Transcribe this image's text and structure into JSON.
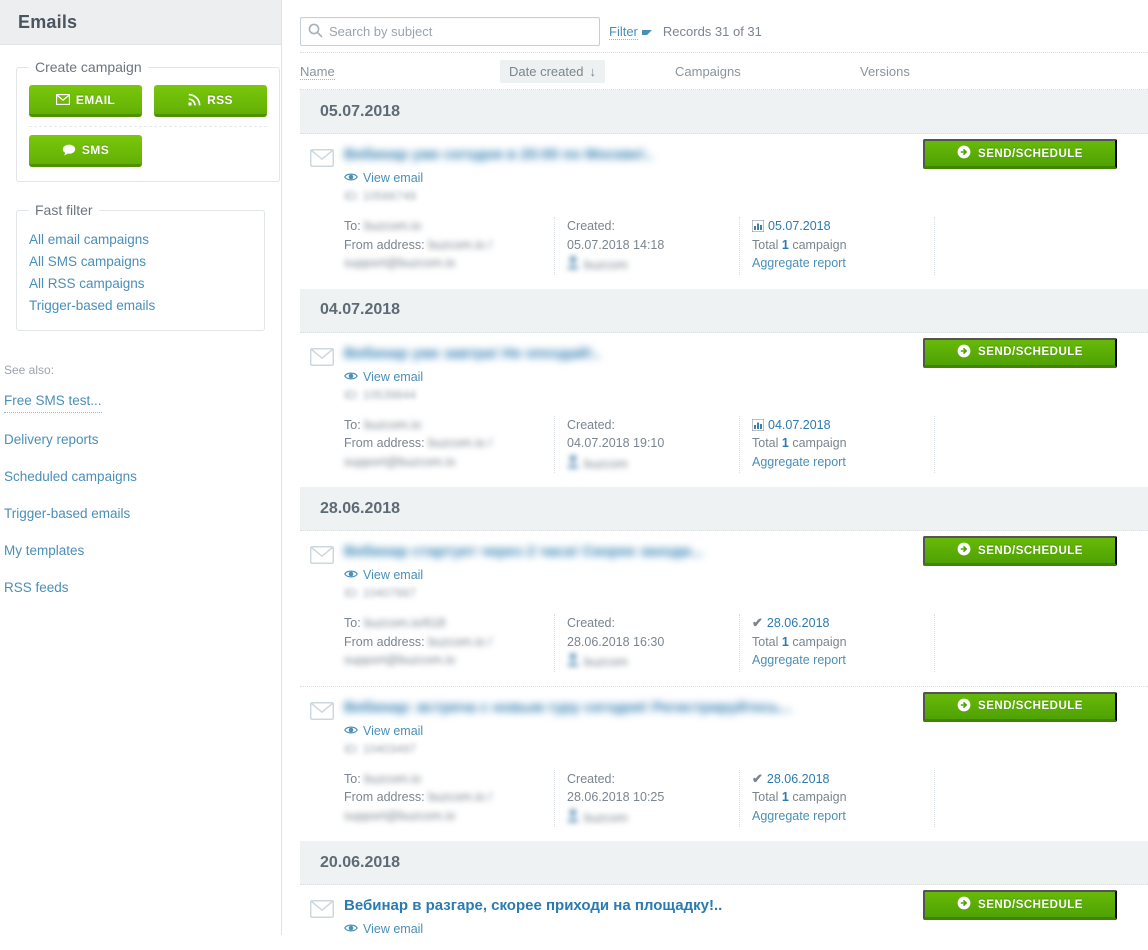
{
  "sidebar": {
    "header_title": "Emails",
    "create_campaign": {
      "legend": "Create campaign",
      "buttons": [
        {
          "label": "EMAIL",
          "icon": "envelope-icon",
          "color": "#6fbb06"
        },
        {
          "label": "RSS",
          "icon": "rss-icon",
          "color": "#6fbb06"
        },
        {
          "label": "SMS",
          "icon": "chat-bubble-icon",
          "color": "#6fbb06"
        }
      ]
    },
    "fast_filter": {
      "legend": "Fast filter",
      "items": [
        {
          "label": "All email campaigns"
        },
        {
          "label": "All SMS campaigns"
        },
        {
          "label": "All RSS campaigns"
        },
        {
          "label": "Trigger-based emails"
        }
      ]
    },
    "see_also": {
      "label": "See also:",
      "items": [
        {
          "label": "Free SMS test...",
          "dotted": true
        },
        {
          "label": "Delivery reports",
          "dotted": false
        },
        {
          "label": "Scheduled campaigns",
          "dotted": false
        },
        {
          "label": "Trigger-based emails",
          "dotted": false
        },
        {
          "label": "My templates",
          "dotted": false
        },
        {
          "label": "RSS feeds",
          "dotted": false
        }
      ]
    }
  },
  "toolbar": {
    "search_placeholder": "Search by subject",
    "search_value": "",
    "search_icon": "search-icon",
    "filter_label": "Filter",
    "records_label": "Records 31 of 31"
  },
  "table": {
    "columns": {
      "name": "Name",
      "date_created": "Date created",
      "sort_arrow": "↓",
      "campaigns": "Campaigns",
      "versions": "Versions"
    },
    "groups": [
      {
        "date": "05.07.2018",
        "rows": [
          {
            "subject": "Вебинар уже сегодня в 20:00 по Москве!..",
            "subject_blurred": true,
            "view_email": "View email",
            "id_line": "ID: 10566749",
            "id_blurred": true,
            "to_label": "To:",
            "to_value": "buzcom.io",
            "from_label": "From address:",
            "from_value": "buzcom.io / support@buzcom.io",
            "created_label": "Created:",
            "created_value": "05.07.2018 14:18",
            "creator": "buzcom",
            "campaign_icon": "bar-chart-icon",
            "campaign_date": "05.07.2018",
            "campaign_total_prefix": "Total",
            "campaign_total_count": "1",
            "campaign_total_suffix": "campaign",
            "aggregate_report": "Aggregate report",
            "send_button": "SEND/SCHEDULE"
          }
        ]
      },
      {
        "date": "04.07.2018",
        "rows": [
          {
            "subject": "Вебинар уже завтра! Не опоздай!..",
            "subject_blurred": true,
            "view_email": "View email",
            "id_line": "ID: 10539844",
            "id_blurred": true,
            "to_label": "To:",
            "to_value": "buzcom.io",
            "from_label": "From address:",
            "from_value": "buzcom.io / support@buzcom.io",
            "created_label": "Created:",
            "created_value": "04.07.2018 19:10",
            "creator": "buzcom",
            "campaign_icon": "bar-chart-icon",
            "campaign_date": "04.07.2018",
            "campaign_total_prefix": "Total",
            "campaign_total_count": "1",
            "campaign_total_suffix": "campaign",
            "aggregate_report": "Aggregate report",
            "send_button": "SEND/SCHEDULE"
          }
        ]
      },
      {
        "date": "28.06.2018",
        "rows": [
          {
            "subject": "Вебинар стартует через 2 часа! Скорее заходи...",
            "subject_blurred": true,
            "view_email": "View email",
            "id_line": "ID: 10407887",
            "id_blurred": true,
            "to_label": "To:",
            "to_value": "buzcom.io/618",
            "from_label": "From address:",
            "from_value": "buzcom.io / support@buzcom.io",
            "created_label": "Created:",
            "created_value": "28.06.2018 16:30",
            "creator": "buzcom",
            "campaign_icon": "check-icon",
            "campaign_date": "28.06.2018",
            "campaign_total_prefix": "Total",
            "campaign_total_count": "1",
            "campaign_total_suffix": "campaign",
            "aggregate_report": "Aggregate report",
            "send_button": "SEND/SCHEDULE"
          },
          {
            "subject": "Вебинар: встреча с новым гуру сегодня! Регистрируйтесь...",
            "subject_blurred": true,
            "view_email": "View email",
            "id_line": "ID: 10403497",
            "id_blurred": true,
            "to_label": "To:",
            "to_value": "buzcom.io",
            "from_label": "From address:",
            "from_value": "buzcom.io / support@buzcom.io",
            "created_label": "Created:",
            "created_value": "28.06.2018 10:25",
            "creator": "buzcom",
            "campaign_icon": "check-icon",
            "campaign_date": "28.06.2018",
            "campaign_total_prefix": "Total",
            "campaign_total_count": "1",
            "campaign_total_suffix": "campaign",
            "aggregate_report": "Aggregate report",
            "send_button": "SEND/SCHEDULE"
          }
        ]
      },
      {
        "date": "20.06.2018",
        "rows": [
          {
            "subject": "Вебинар в разгаре, скорее приходи на площадку!..",
            "subject_blurred": false,
            "view_email": "View email",
            "id_line": "",
            "id_blurred": false,
            "to_label": "",
            "to_value": "",
            "from_label": "",
            "from_value": "",
            "created_label": "",
            "created_value": "",
            "creator": "",
            "campaign_icon": "",
            "campaign_date": "",
            "campaign_total_prefix": "",
            "campaign_total_count": "",
            "campaign_total_suffix": "",
            "aggregate_report": "",
            "send_button": "SEND/SCHEDULE"
          }
        ]
      }
    ]
  },
  "colors": {
    "green": "#67b908",
    "link_blue": "#4a8fb8",
    "subject_blue": "#2b7bb0",
    "band_gray": "#eef2f3"
  }
}
